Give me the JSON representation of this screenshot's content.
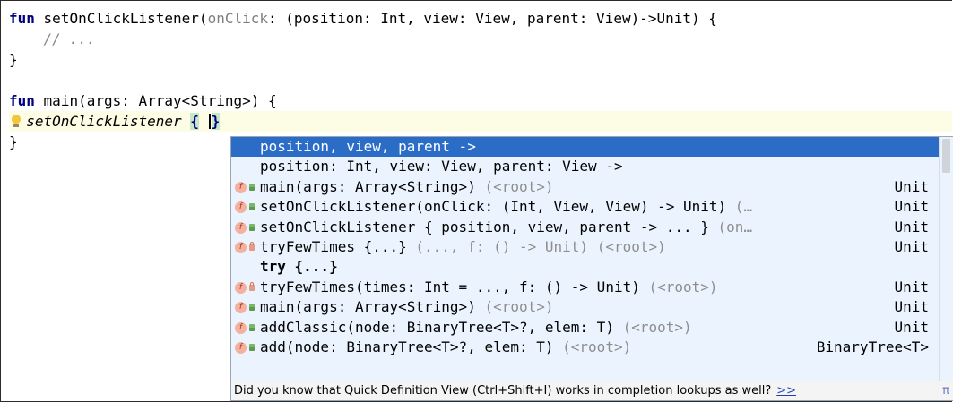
{
  "editor": {
    "line1": {
      "kw": "fun",
      "name": " setOnClickListener(",
      "param": "onClick",
      "rest": ": (position: Int, view: View, parent: View)->Unit) {"
    },
    "line2": "    // ...",
    "line3": "}",
    "line5": {
      "kw": "fun",
      "rest": " main(args: Array<String>) {"
    },
    "line6": {
      "indent": "  ",
      "call": "setOnClickListener",
      "open": "{",
      "close": "}"
    },
    "line7": "}"
  },
  "completion": {
    "items": [
      {
        "icon": "",
        "text": "position, view, parent ->",
        "grey": "",
        "type": ""
      },
      {
        "icon": "",
        "text": "position: Int, view: View, parent: View ->",
        "grey": "",
        "type": ""
      },
      {
        "icon": "f",
        "vis": "pub",
        "text": "main(args: Array<String>)",
        "grey": " (<root>)",
        "type": "Unit"
      },
      {
        "icon": "f",
        "vis": "pub",
        "text": "setOnClickListener(onClick: (Int, View, View) -> Unit)",
        "grey": " (…",
        "type": "Unit"
      },
      {
        "icon": "f",
        "vis": "pub",
        "text": "setOnClickListener { position, view, parent -> ... }",
        "grey": " (on…",
        "type": "Unit"
      },
      {
        "icon": "f",
        "vis": "priv",
        "text": "tryFewTimes {...}",
        "grey": " (..., f: () -> Unit) (<root>)",
        "type": "Unit"
      },
      {
        "icon": "",
        "text": "try {...}",
        "grey": "",
        "type": "",
        "bold": true
      },
      {
        "icon": "f",
        "vis": "priv",
        "text": "tryFewTimes(times: Int = ..., f: () -> Unit)",
        "grey": " (<root>)",
        "type": "Unit"
      },
      {
        "icon": "f",
        "vis": "pub",
        "text": "main(args: Array<String>)",
        "grey": " (<root>)",
        "type": "Unit"
      },
      {
        "icon": "f",
        "vis": "pub",
        "text": "addClassic(node: BinaryTree<T>?, elem: T)",
        "grey": " (<root>)",
        "type": "Unit"
      },
      {
        "icon": "f",
        "vis": "pub",
        "text": "add(node: BinaryTree<T>?, elem: T)",
        "grey": " (<root>)",
        "type": "BinaryTree<T>"
      }
    ],
    "tip": "Did you know that Quick Definition View (Ctrl+Shift+I) works in completion lookups as well?",
    "tip_link": ">>",
    "tip_icon": "π"
  }
}
